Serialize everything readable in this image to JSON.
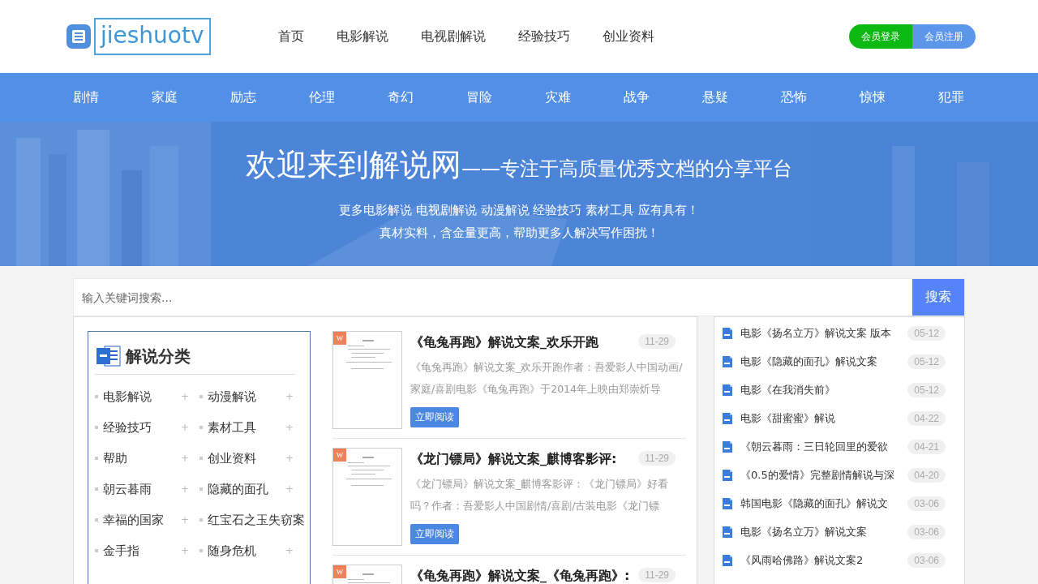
{
  "header": {
    "logo": "jieshuotv",
    "nav": [
      {
        "label": "首页"
      },
      {
        "label": "电影解说"
      },
      {
        "label": "电视剧解说"
      },
      {
        "label": "经验技巧"
      },
      {
        "label": "创业资料"
      }
    ],
    "login": "会员登录",
    "register": "会员注册"
  },
  "genres": [
    "剧情",
    "家庭",
    "励志",
    "伦理",
    "奇幻",
    "冒险",
    "灾难",
    "战争",
    "悬疑",
    "恐怖",
    "惊悚",
    "犯罪"
  ],
  "banner": {
    "title": "欢迎来到解说网",
    "subtitle": "——专注于高质量优秀文档的分享平台",
    "lines": [
      "更多电影解说 电视剧解说 动漫解说 经验技巧 素材工具 应有具有！",
      "真材实料，含金量更高，帮助更多人解决写作困扰！"
    ]
  },
  "search": {
    "placeholder": "输入关键词搜索...",
    "button": "搜索"
  },
  "categories": {
    "title": "解说分类",
    "items": [
      {
        "label": "电影解说",
        "toggle": "+"
      },
      {
        "label": "动漫解说",
        "toggle": "+"
      },
      {
        "label": "经验技巧",
        "toggle": "+"
      },
      {
        "label": "素材工具",
        "toggle": "+"
      },
      {
        "label": "帮助",
        "toggle": "+"
      },
      {
        "label": "创业资料",
        "toggle": "+"
      },
      {
        "label": "朝云暮雨",
        "toggle": "+"
      },
      {
        "label": "隐藏的面孔",
        "toggle": "+"
      },
      {
        "label": "幸福的国家",
        "toggle": "+"
      },
      {
        "label": "红宝石之玉失窃案"
      },
      {
        "label": "金手指",
        "toggle": "+"
      },
      {
        "label": "随身危机",
        "toggle": "+"
      }
    ]
  },
  "articles": [
    {
      "badge": "W",
      "title": "《龟兔再跑》解说文案_欢乐开跑",
      "date": "11-29",
      "excerpt": "《龟兔再跑》解说文案_欢乐开跑作者：吾爱影人中国动画/家庭/喜剧电影《龟兔再跑》于2014年上映由郑崇炘导",
      "button": "立即阅读"
    },
    {
      "badge": "W",
      "title": "《龙门镖局》解说文案_麒博客影评:",
      "date": "11-29",
      "excerpt": "《龙门镖局》解说文案_麒博客影评：《龙门镖局》好看吗？作者：吾爱影人中国剧情/喜剧/古装电影《龙门镖",
      "button": "立即阅读"
    },
    {
      "badge": "W",
      "title": "《龟兔再跑》解说文案_《龟兔再跑》:",
      "date": "11-29"
    }
  ],
  "recent": [
    {
      "title": "电影《扬名立万》解说文案 版本",
      "date": "05-12"
    },
    {
      "title": "电影《隐藏的面孔》解说文案",
      "date": "05-12"
    },
    {
      "title": "电影《在我消失前》",
      "date": "05-12"
    },
    {
      "title": "电影《甜蜜蜜》解说",
      "date": "04-22"
    },
    {
      "title": "《朝云暮雨：三日轮回里的爱欲",
      "date": "04-21"
    },
    {
      "title": "《0.5的爱情》完整剧情解说与深",
      "date": "04-20"
    },
    {
      "title": "韩国电影《隐藏的面孔》解说文",
      "date": "03-06"
    },
    {
      "title": "电影《扬名立万》解说文案",
      "date": "03-06"
    },
    {
      "title": "《风雨哈佛路》解说文案2",
      "date": "03-06"
    }
  ]
}
